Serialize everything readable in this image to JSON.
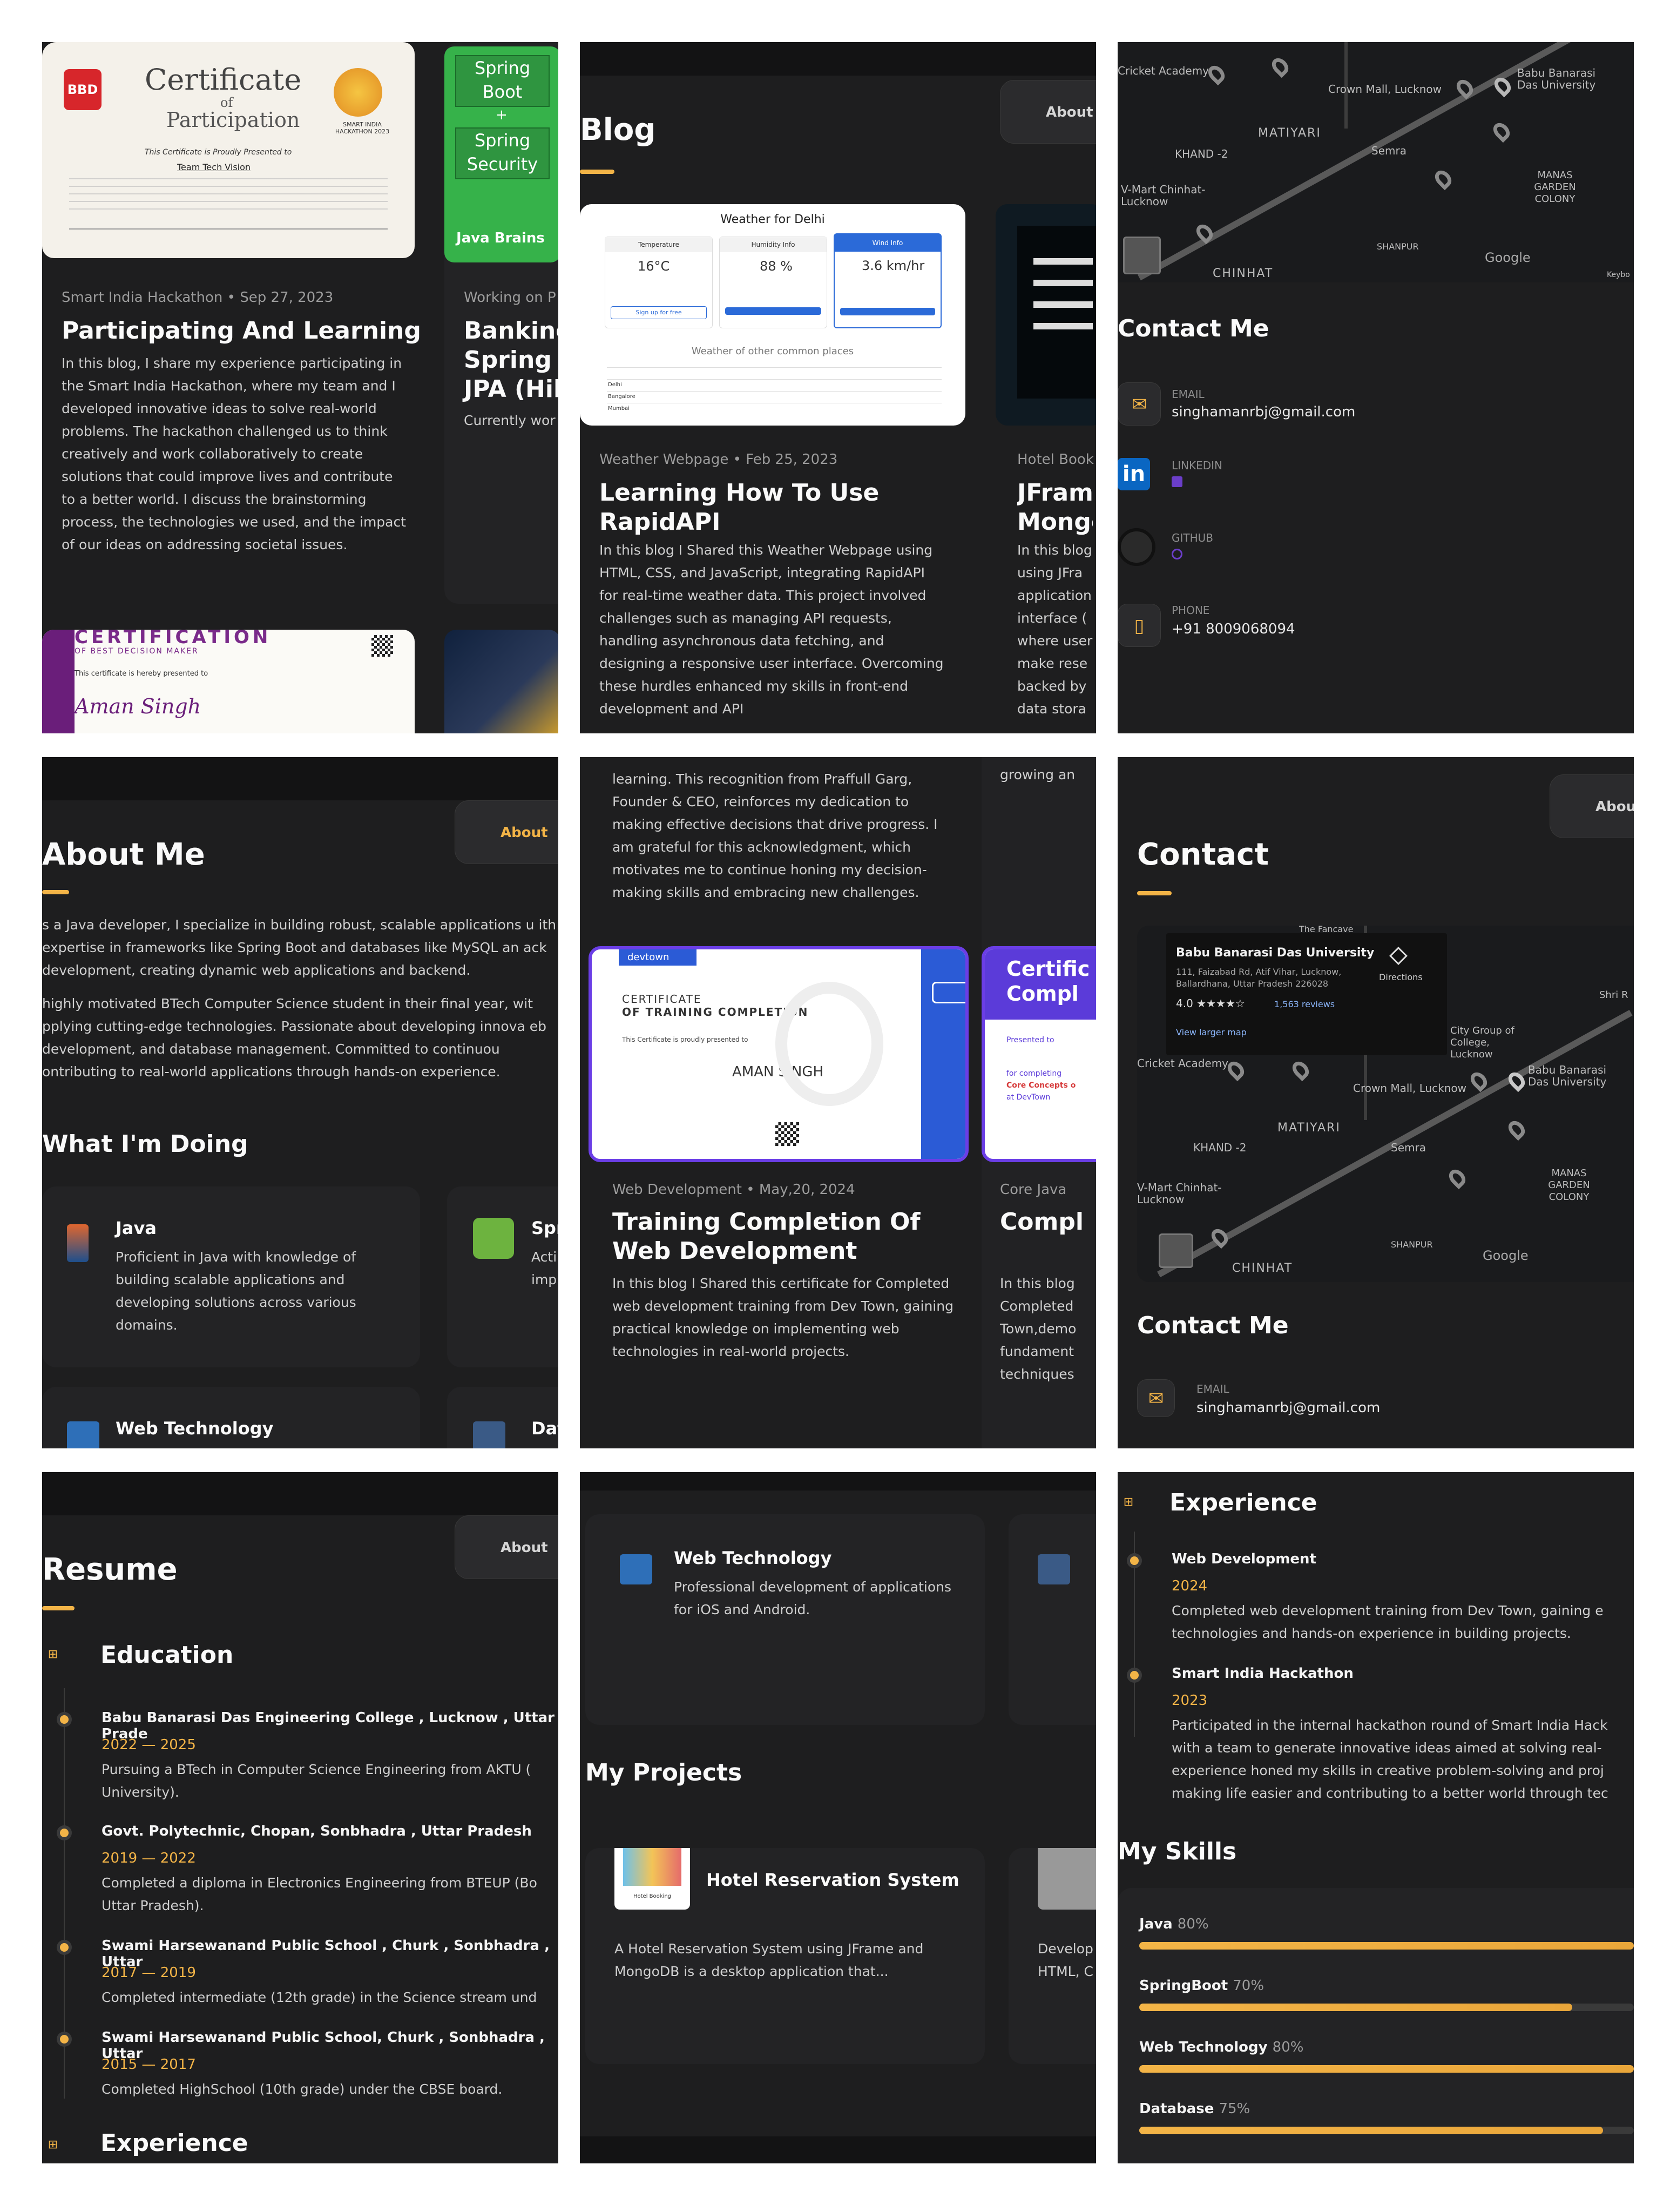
{
  "p1": {
    "cert": {
      "title": "Certificate",
      "of": "of",
      "participation": "Participation",
      "badge": "SMART INDIA HACKATHON 2023",
      "sub": "This Certificate is Proudly Presented to",
      "team": "Team Tech Vision",
      "logo": "BBD"
    },
    "spring": {
      "l1": "Spring",
      "l2": "Boot",
      "plus": "+",
      "l3": "Spring",
      "l4": "Security",
      "brand": "Java Brains"
    },
    "meta": "Smart India Hackathon • Sep 27, 2023",
    "title": "Participating And Learning",
    "body": "In this blog, I share my experience participating in the Smart India Hackathon, where my team and I developed innovative ideas to solve real-world problems. The hackathon challenged us to think creatively and work collaboratively to create solutions that could improve lives and contribute to a better world. I discuss the brainstorming process, the technologies we used, and the impact of our ideas on addressing societal issues.",
    "meta2": "Working on P",
    "title2": "Banking Spring B JPA (Hib",
    "body2": "Currently wor",
    "cert2": {
      "head": "CERTIFICATION",
      "sub": "OF BEST DECISION MAKER",
      "line": "This certificate is hereby presented to",
      "name": "Aman Singh"
    }
  },
  "p2": {
    "title": "Blog",
    "nav": "About",
    "weather": {
      "head": "Weather for Delhi",
      "c1": "Temperature",
      "c2": "Humidity Info",
      "c3": "Wind Info",
      "v1": "16°C",
      "v2": "88 %",
      "v3": "3.6 km/hr",
      "btn": "Sign up for free",
      "sub": "Weather of other common places",
      "rows": [
        "Delhi",
        "Bangalore",
        "Mumbai"
      ]
    },
    "meta": "Weather Webpage • Feb 25, 2023",
    "title1": "Learning How To Use RapidAPI",
    "body1": "In this blog I Shared this Weather Webpage using HTML, CSS, and JavaScript, integrating RapidAPI for real-time weather data. This project involved challenges such as managing API requests, handling asynchronous data fetching, and designing a responsive user interface. Overcoming these hurdles enhanced my skills in front-end development and API",
    "meta2": "Hotel Book",
    "title2": "JFram Mongo",
    "body2": "In this blog using JFra application interface ( where user make rese backed by data stora"
  },
  "p3": {
    "map": {
      "l1": "Cricket Academy",
      "l2": "Crown Mall, Lucknow",
      "l3": "Babu Banarasi Das University",
      "l4": "MATIYARI",
      "l5": "KHAND -2",
      "l6": "Semra",
      "l7": "MANAS GARDEN COLONY",
      "l8": "V-Mart Chinhat-Lucknow",
      "l9": "CHINHAT",
      "l10": "SHANPUR",
      "l11": "Google",
      "l12": "Keybo"
    },
    "title": "Contact Me",
    "email_lbl": "EMAIL",
    "email": "singhamanrbj@gmail.com",
    "linkedin_lbl": "LINKEDIN",
    "linkedin_icon": "in",
    "github_lbl": "GITHUB",
    "phone_lbl": "PHONE",
    "phone": "+91 8009068094"
  },
  "p4": {
    "title": "About Me",
    "nav": "About",
    "para1": "s a Java developer, I specialize in building robust, scalable applications u ith expertise in frameworks like Spring Boot and databases like MySQL an ack development, creating dynamic web applications and backend.",
    "para2": "highly motivated BTech Computer Science student in their final year, wit pplying cutting-edge technologies. Passionate about developing innova eb development, and database management. Committed to continuou ontributing to real-world applications through hands-on experience.",
    "doing": "What I'm Doing",
    "java_t": "Java",
    "java_d": "Proficient in Java with knowledge of building scalable applications and developing solutions across various domains.",
    "spr_t": "Spr",
    "spr_d": "Acti imp",
    "web_t": "Web Technology",
    "dat_t": "Dat"
  },
  "p5": {
    "top": "learning. This recognition from Praffull Garg, Founder & CEO, reinforces my dedication to making effective decisions that drive progress. I am grateful for this acknowledgment, which motivates me to continue honing my decision-making skills and embracing new challenges.",
    "top2": "growing an",
    "cert": {
      "brand": "devtown",
      "l1": "CERTIFICATE",
      "l2": "OF TRAINING COMPLETION",
      "line": "This Certificate is proudly presented to",
      "name": "AMAN SINGH"
    },
    "cert2": {
      "l1": "Certific",
      "l2": "Compl",
      "l3": "Presented to",
      "l4": "for completing",
      "l5": "Core Concepts o",
      "l6": "at DevTown"
    },
    "meta": "Web Development • May,20, 2024",
    "title": "Training Completion Of Web Development",
    "body": "In this blog I Shared this certificate for Completed web development training from Dev Town, gaining practical knowledge on implementing web technologies in real-world projects.",
    "meta2": "Core Java",
    "title2": "Compl",
    "body2": "In this blog Completed Town,demo fundament techniques"
  },
  "p6": {
    "nav": "Abou",
    "title": "Contact",
    "mapcard": {
      "name": "Babu Banarasi Das University",
      "addr1": "111, Faizabad Rd, Atif Vihar, Lucknow,",
      "addr2": "Ballardhana, Uttar Pradesh 226028",
      "rating": "4.0 ★★★★☆",
      "reviews": "1,563 reviews",
      "link": "View larger map",
      "dir": "Directions"
    },
    "map": {
      "l1": "Cricket Academy",
      "l2": "Crown Mall, Lucknow",
      "l3": "Babu Banarasi Das University",
      "l4": "MATIYARI",
      "l5": "KHAND -2",
      "l6": "Semra",
      "l7": "MANAS GARDEN COLONY",
      "l8": "V-Mart Chinhat-Lucknow",
      "l9": "CHINHAT",
      "l10": "SHANPUR",
      "l11": "Google",
      "l12": "City Group of College, Lucknow",
      "l13": "Shri R",
      "l14": "The Fancave"
    },
    "sub": "Contact Me",
    "email_lbl": "EMAIL",
    "email": "singhamanrbj@gmail.com"
  },
  "p7": {
    "nav": "About",
    "title": "Resume",
    "edu": "Education",
    "items": [
      {
        "t": "Babu Banarasi Das Engineering College , Lucknow , Uttar Prade",
        "y": "2022 — 2025",
        "d": "Pursuing a BTech in Computer Science Engineering from AKTU (\nUniversity)."
      },
      {
        "t": "Govt. Polytechnic, Chopan, Sonbhadra , Uttar Pradesh",
        "y": "2019 — 2022",
        "d": "Completed a diploma in Electronics Engineering from BTEUP (Bo\nUttar Pradesh)."
      },
      {
        "t": "Swami Harsewanand Public School , Churk , Sonbhadra , Uttar",
        "y": "2017 — 2019",
        "d": "Completed intermediate (12th grade) in the Science stream und"
      },
      {
        "t": "Swami Harsewanand Public School, Churk , Sonbhadra , Uttar",
        "y": "2015 — 2017",
        "d": "Completed HighSchool (10th grade) under the CBSE board."
      }
    ],
    "exp": "Experience"
  },
  "p8": {
    "web_t": "Web Technology",
    "web_d": "Professional development of applications for iOS and Android.",
    "proj": "My Projects",
    "hotel_t": "Hotel Reservation System",
    "hotel_d": "A Hotel Reservation System using JFrame and MongoDB is a desktop application that...",
    "hotel_img": "Hotel Booking",
    "dev_d": "Develop HTML, C"
  },
  "p9": {
    "exp": "Experience",
    "items": [
      {
        "t": "Web Development",
        "y": "2024",
        "d": "Completed web development training from Dev Town, gaining e technologies and hands-on experience in building projects."
      },
      {
        "t": "Smart India Hackathon",
        "y": "2023",
        "d": "Participated in the internal hackathon round of Smart India Hack with a team to generate innovative ideas aimed at solving real- experience honed my skills in creative problem-solving and proj making life easier and contributing to a better world through tec"
      }
    ],
    "skills": "My Skills",
    "sk": [
      {
        "n": "Java",
        "p": "80%",
        "v": 0.8
      },
      {
        "n": "SpringBoot",
        "p": "70%",
        "v": 0.7
      },
      {
        "n": "Web Technology",
        "p": "80%",
        "v": 0.8
      },
      {
        "n": "Database",
        "p": "75%",
        "v": 0.75
      }
    ]
  },
  "colors": {
    "accent": "#f3b447",
    "bg": "#1e1e1f",
    "card": "#232325"
  }
}
